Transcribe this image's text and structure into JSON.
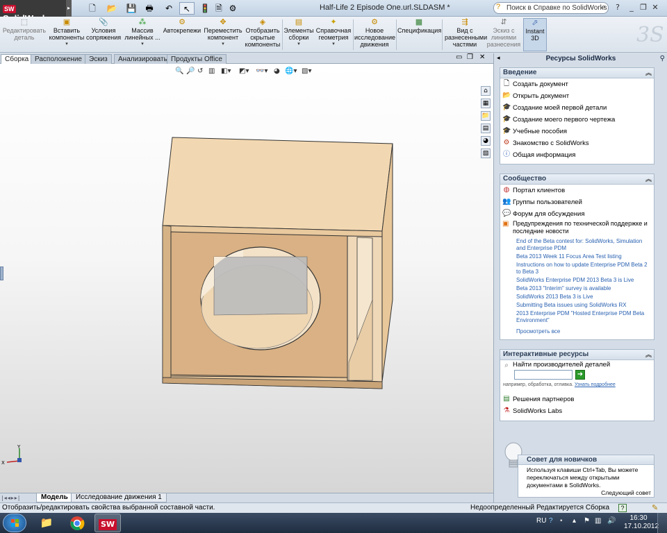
{
  "app": {
    "logo": "SolidWorks",
    "logo_badge": "SW",
    "document_title": "Half-Life 2 Episode One.url.SLDASM *"
  },
  "search": {
    "placeholder": "Поиск в Справке по SolidWorks"
  },
  "toolbar": {
    "items": [
      {
        "label": "Редактировать деталь",
        "icon": "edit-part-icon"
      },
      {
        "label": "Вставить компоненты",
        "icon": "insert-components-icon"
      },
      {
        "label": "Условия сопряжения",
        "icon": "mate-icon"
      },
      {
        "label": "Массив линейных ...",
        "icon": "linear-pattern-icon"
      },
      {
        "label": "Автокрепежи",
        "icon": "smart-fasteners-icon"
      },
      {
        "label": "Переместить компонент",
        "icon": "move-component-icon"
      },
      {
        "label": "Отобразить скрытые компоненты",
        "icon": "show-hidden-icon"
      },
      {
        "label": "Элементы сборки",
        "icon": "assembly-features-icon"
      },
      {
        "label": "Справочная геометрия",
        "icon": "reference-geometry-icon"
      },
      {
        "label": "Новое исследование движения",
        "icon": "motion-study-icon"
      },
      {
        "label": "Спецификация",
        "icon": "bom-icon"
      },
      {
        "label": "Вид с разнесенными частями",
        "icon": "exploded-view-icon"
      },
      {
        "label": "Эскиз с линиями разнесения",
        "icon": "explode-line-sketch-icon"
      },
      {
        "label": "Instant 3D",
        "icon": "instant3d-icon"
      }
    ]
  },
  "tabs": [
    "Сборка",
    "Расположение",
    "Эскиз",
    "Анализировать",
    "Продукты Office"
  ],
  "bottom_tabs": [
    "Модель",
    "Исследование движения 1"
  ],
  "status": {
    "message": "Отобразить/редактировать свойства выбранной составной части.",
    "definition": "Недоопределенный",
    "editing": "Редактируется Сборка",
    "help": "?"
  },
  "taskpane": {
    "title": "Ресурсы SolidWorks",
    "intro": {
      "title": "Введение",
      "items": [
        "Создать документ",
        "Открыть документ",
        "Создание моей первой детали",
        "Создание моего первого чертежа",
        "Учебные пособия",
        "Знакомство с SolidWorks",
        "Общая информация"
      ]
    },
    "community": {
      "title": "Сообщество",
      "items": [
        "Портал клиентов",
        "Группы пользователей",
        "Форум для обсуждения",
        "Предупреждения по технической поддержке и последние новости"
      ],
      "news": [
        "End of the Beta contest for: SolidWorks, Simulation and Enterprise PDM",
        "Beta 2013 Week 11 Focus Area Test listing",
        "Instructions on how to update Enterprise PDM Beta 2 to Beta 3",
        "SolidWorks Enterprise PDM 2013 Beta 3 is Live",
        "Beta 2013 \"Interim\" survey is available",
        "SolidWorks 2013 Beta 3 is Live",
        "Submitting Beta issues using SolidWorks RX",
        "2013 Enterprise PDM \"Hosted Enterprise PDM Beta Environment\""
      ],
      "view_all": "Просмотреть все"
    },
    "interactive": {
      "title": "Интерактивные ресурсы",
      "find_label": "Найти производителей деталей",
      "hint": "например, обработка, отливка.",
      "learn_more": "Узнать подробнее",
      "items": [
        "Решения партнеров",
        "SolidWorks Labs"
      ]
    },
    "tip": {
      "title": "Совет для новичков",
      "body": "Используя клавиши Ctrl+Tab, Вы можете переключаться между открытыми документами в SolidWorks.",
      "next": "Следующий совет"
    }
  },
  "taskbar": {
    "lang": "RU",
    "time": "16:30",
    "date": "17.10.2012"
  },
  "triad": {
    "y": "Y",
    "x": "X"
  }
}
